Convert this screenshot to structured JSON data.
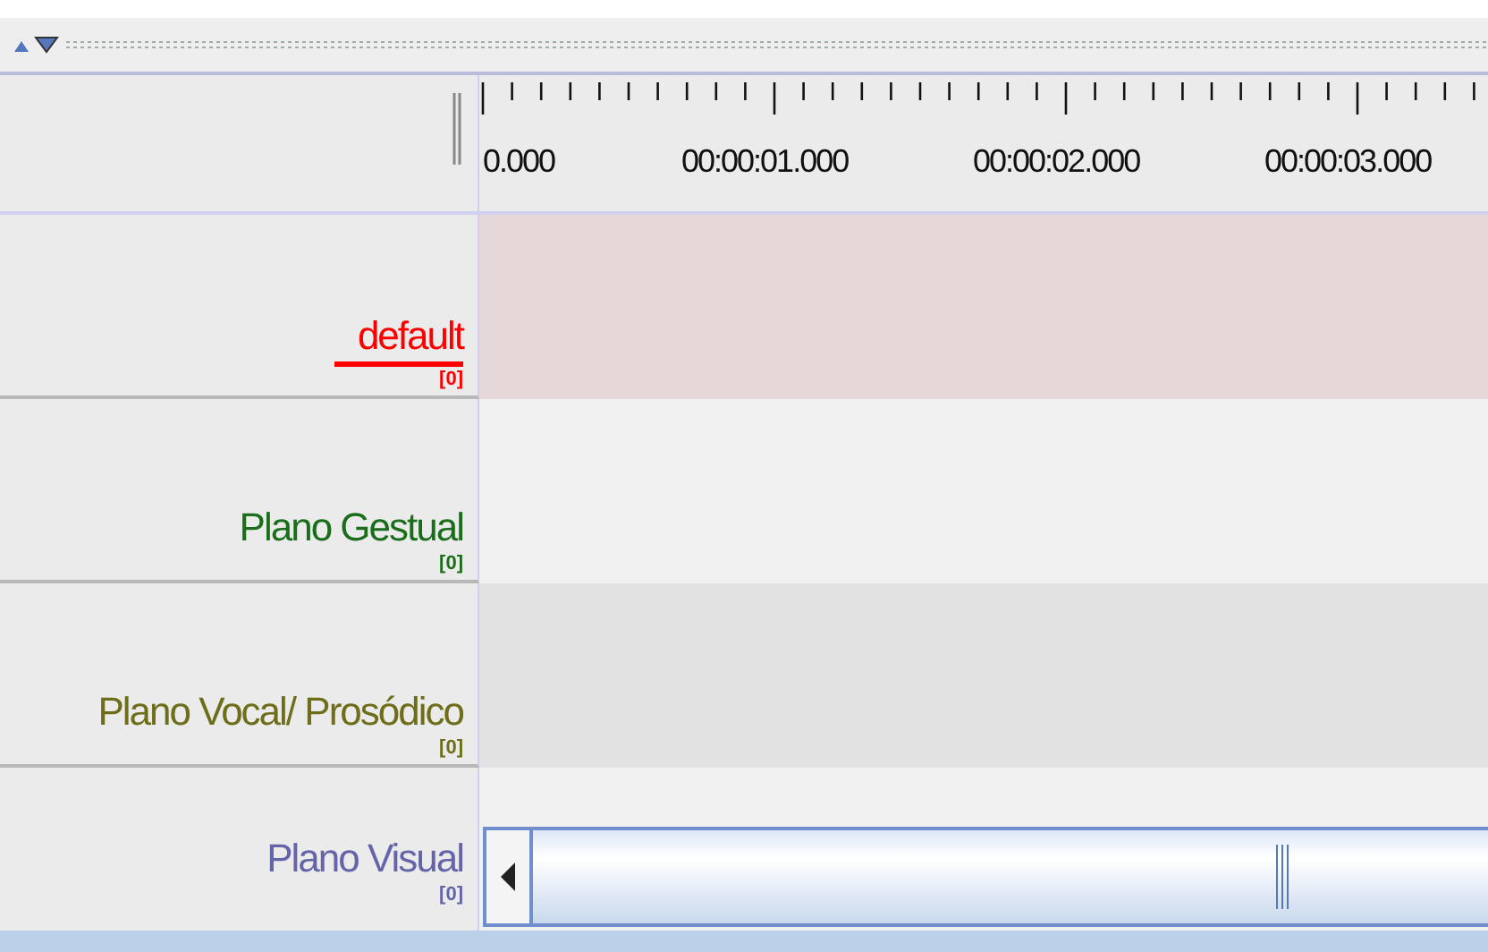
{
  "ruler": {
    "labels": [
      "0.000",
      "00:00:01.000",
      "00:00:02.000",
      "00:00:03.000"
    ]
  },
  "tiers": [
    {
      "name": "default",
      "count": "[0]",
      "color": "#ff0000",
      "selected": true
    },
    {
      "name": "Plano Gestual",
      "count": "[0]",
      "color": "#1a6e1a",
      "selected": false
    },
    {
      "name": "Plano Vocal/ Prosódico",
      "count": "[0]",
      "color": "#6e6e1a",
      "selected": false
    },
    {
      "name": "Plano Visual",
      "count": "[0]",
      "color": "#6464a8",
      "selected": false
    }
  ]
}
